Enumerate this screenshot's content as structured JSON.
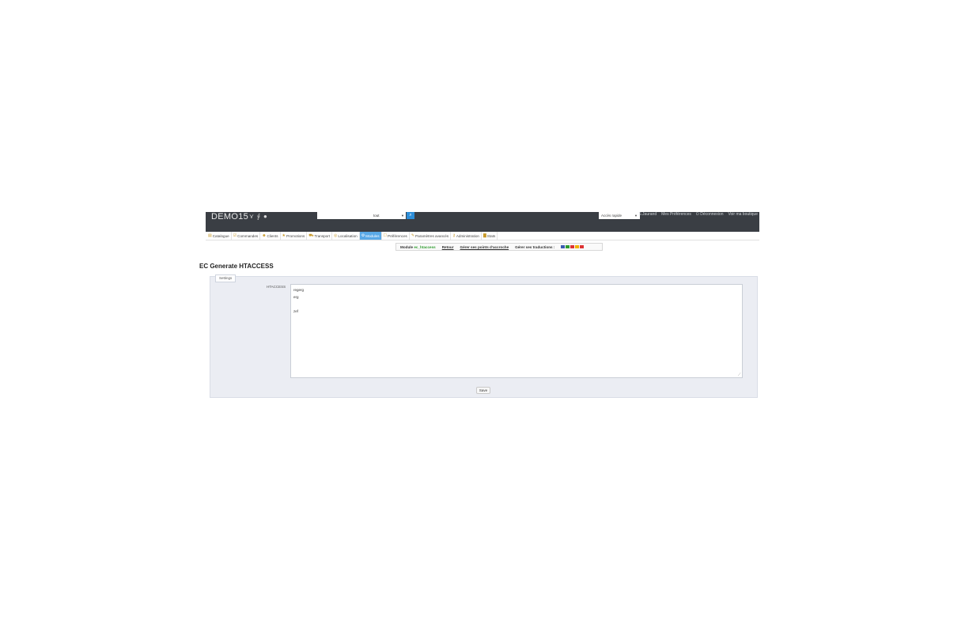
{
  "header": {
    "shop_name": "DEMO15",
    "quick_icons": [
      "⋎",
      "⨚",
      "●"
    ],
    "search_scope": "tout",
    "search_icon": "⌕",
    "quick_access": "Accès rapide",
    "user_links": [
      "S.Jaurand",
      "Mes Préférences",
      "Déconnexion",
      "Voir ma boutique"
    ]
  },
  "tabs": [
    {
      "label": "Catalogue",
      "icon": "▤"
    },
    {
      "label": "Commandes",
      "icon": "☑"
    },
    {
      "label": "Clients",
      "icon": "☻"
    },
    {
      "label": "Promotions",
      "icon": "★"
    },
    {
      "label": "Transport",
      "icon": "⛟"
    },
    {
      "label": "Localisation",
      "icon": "◎"
    },
    {
      "label": "Modules",
      "icon": "⚙"
    },
    {
      "label": "Préférences",
      "icon": "☐"
    },
    {
      "label": "Paramètres avancés",
      "icon": "✎"
    },
    {
      "label": "Administration",
      "icon": "⚷"
    },
    {
      "label": "Stats",
      "icon": "▇"
    }
  ],
  "active_tab": "Modules",
  "module_toolbar": {
    "module_prefix": "Module",
    "module_name": "ec_htaccess",
    "back": "Retour",
    "hooks": "Gérer ses points d'accroche",
    "translations": "Gérer ses traductions :",
    "flag_colors": [
      "#3a5bb0",
      "#2f9c2f",
      "#d33",
      "#f0b000",
      "#d33"
    ]
  },
  "page_title": "EC Generate HTACCESS",
  "settings": {
    "legend": "Settings",
    "field_label": "HTACCESS",
    "htaccess_value": "regerg\nerg\n\nzef",
    "save_label": "Save"
  }
}
